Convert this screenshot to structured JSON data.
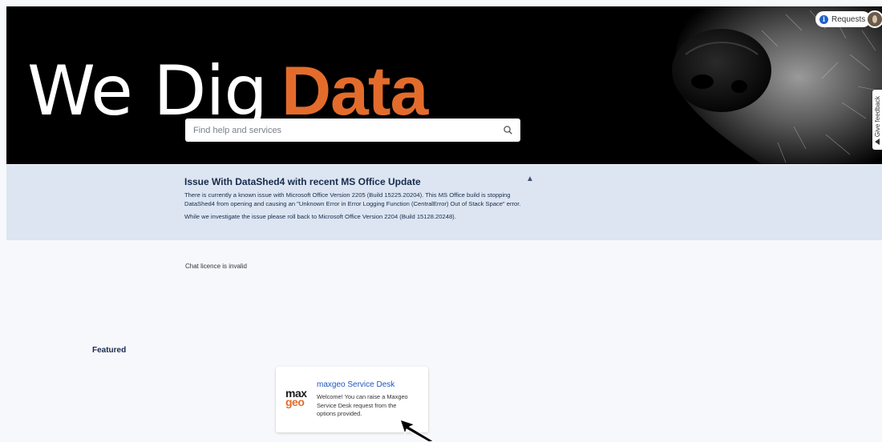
{
  "hero": {
    "title_part1": "We Dig",
    "title_part2": "Data"
  },
  "header": {
    "requests_label": "Requests",
    "feedback_label": "Give feedback"
  },
  "search": {
    "placeholder": "Find help and services"
  },
  "announcement": {
    "title": "Issue With DataShed4 with recent MS Office Update",
    "paragraph1": "There is currently a known issue with Microsoft Office Version 2205 (Build 15225.20204). This MS Office build is stopping DataShed4 from opening and causing an \"Unknown Error in Error Logging Function (CentralError) Out of Stack Space\" error.",
    "paragraph2": "While we investigate the issue please roll back to Microsoft Office Version 2204 (Build 15128.20248)."
  },
  "chat": {
    "message": "Chat licence is invalid"
  },
  "featured": {
    "heading": "Featured",
    "card": {
      "logo_line1": "max",
      "logo_line2": "geo",
      "title": "maxgeo Service Desk",
      "description": "Welcome! You can raise a Maxgeo Service Desk request from the options provided."
    }
  },
  "colors": {
    "accent_orange": "#e36c2c",
    "banner_bg": "#000000",
    "announcement_bg": "#dce5f1",
    "link_blue": "#1e56c1"
  }
}
